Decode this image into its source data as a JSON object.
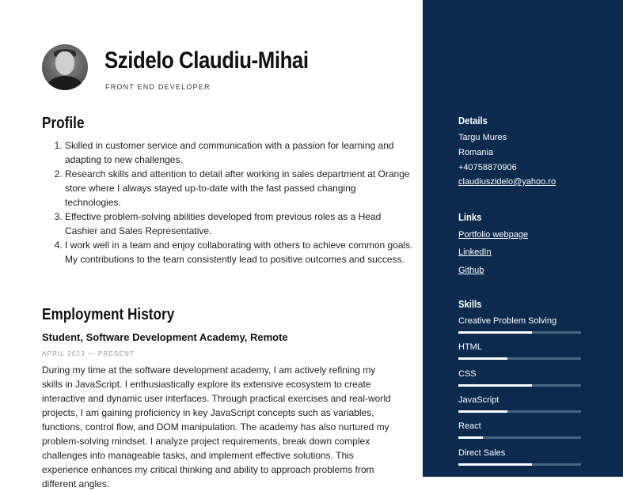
{
  "header": {
    "name": "Szidelo Claudiu-Mihai",
    "role": "FRONT END DEVELOPER"
  },
  "profile": {
    "heading": "Profile",
    "items": [
      "Skilled in customer service and communication with a passion for learning and adapting to new challenges.",
      "Research skills and attention to detail after working in sales department at Orange store where I always stayed up-to-date with the fast passed changing technologies.",
      "Effective problem-solving abilities developed from previous roles as a Head Cashier and Sales Representative.",
      "I work well in a team and enjoy collaborating with others to achieve common goals. My contributions to the team consistently lead to positive outcomes and success."
    ]
  },
  "employment": {
    "heading": "Employment History",
    "jobs": [
      {
        "title": "Student, Software Development Academy, Remote",
        "dates": "APRIL 2023 — PRESENT",
        "description": "During my time at the software development academy, I am actively refining my skills in JavaScript. I enthusiastically explore its extensive ecosystem to create interactive and dynamic user interfaces. Through practical exercises and real-world projects, I am gaining proficiency in key JavaScript concepts such as variables, functions, control flow, and DOM manipulation. The academy has also nurtured my problem-solving mindset. I analyze project requirements, break down complex challenges into manageable tasks, and implement effective solutions. This experience enhances my critical thinking and ability to approach problems from different angles."
      }
    ]
  },
  "sidebar": {
    "details": {
      "heading": "Details",
      "city": "Targu Mures",
      "country": "Romania",
      "phone": "+40758870906",
      "email": "claudiuszidelo@yahoo.ro"
    },
    "links": {
      "heading": "Links",
      "items": [
        "Portfolio webpage",
        "LinkedIn",
        "Github"
      ]
    },
    "skills": {
      "heading": "Skills",
      "items": [
        {
          "label": "Creative Problem Solving",
          "level": 0.6
        },
        {
          "label": "HTML",
          "level": 0.4
        },
        {
          "label": "CSS",
          "level": 0.6
        },
        {
          "label": "JavaScript",
          "level": 0.4
        },
        {
          "label": "React",
          "level": 0.2
        },
        {
          "label": "Direct Sales",
          "level": 0.6
        }
      ]
    }
  },
  "colors": {
    "sidebar_bg": "#0b2a4e",
    "skill_track": "#4a6482",
    "skill_fill": "#ffffff"
  }
}
